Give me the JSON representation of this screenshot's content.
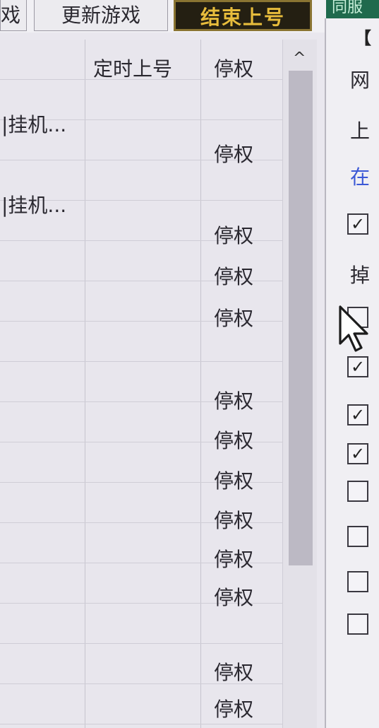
{
  "toolbar": {
    "left_fragment": "戏",
    "update_game": "更新游戏",
    "end_login": "结束上号",
    "green_fragment": "同服"
  },
  "table": {
    "columns": [
      "定时上号",
      "停权"
    ],
    "rows": [
      {
        "name": "|挂机...",
        "status": ""
      },
      {
        "name": "",
        "status": "停权"
      },
      {
        "name": "|挂机...",
        "status": ""
      },
      {
        "name": "",
        "status": "停权"
      },
      {
        "name": "",
        "status": "停权"
      },
      {
        "name": "",
        "status": "停权"
      },
      {
        "name": "",
        "status": "停权"
      },
      {
        "name": "",
        "status": "停权"
      },
      {
        "name": "",
        "status": "停权"
      },
      {
        "name": "",
        "status": "停权"
      },
      {
        "name": "",
        "status": "停权"
      },
      {
        "name": "",
        "status": "停权"
      },
      {
        "name": "",
        "status": "停权"
      },
      {
        "name": "",
        "status": "停权"
      }
    ]
  },
  "scrollbar": {
    "up_glyph": "^"
  },
  "right_panel": {
    "bracket": "【",
    "network_label": "网",
    "login_label": "上",
    "online_label": "在",
    "drop_label": "掉",
    "checkboxes": [
      {
        "checked": true,
        "glyph": "✓"
      },
      {
        "checked": false,
        "glyph": ""
      },
      {
        "checked": true,
        "glyph": "✓"
      },
      {
        "checked": true,
        "glyph": "✓"
      },
      {
        "checked": true,
        "glyph": "✓"
      },
      {
        "checked": false,
        "glyph": ""
      },
      {
        "checked": false,
        "glyph": ""
      },
      {
        "checked": false,
        "glyph": ""
      },
      {
        "checked": false,
        "glyph": ""
      }
    ]
  }
}
